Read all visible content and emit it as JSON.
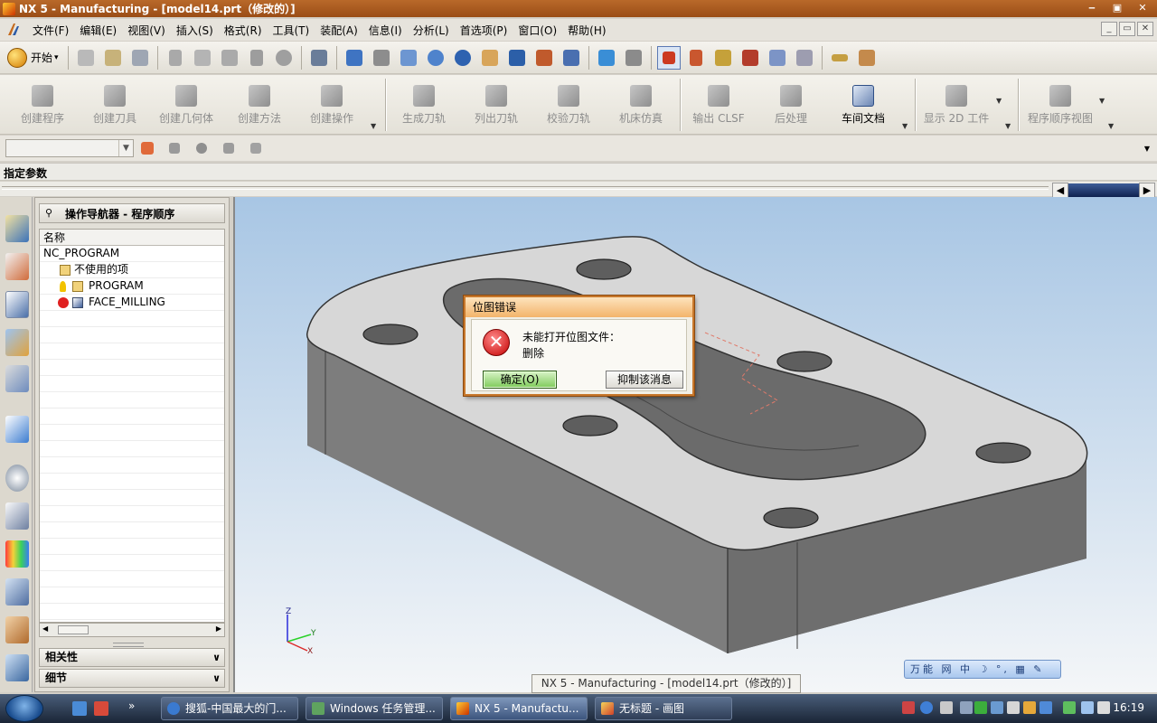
{
  "window": {
    "title": "NX 5 - Manufacturing - [model14.prt（修改的）]",
    "controls": [
      "‒",
      "▣",
      "✕"
    ]
  },
  "menu": {
    "items": [
      "文件(F)",
      "编辑(E)",
      "视图(V)",
      "插入(S)",
      "格式(R)",
      "工具(T)",
      "装配(A)",
      "信息(I)",
      "分析(L)",
      "首选项(P)",
      "窗口(O)",
      "帮助(H)"
    ],
    "mdi_controls": [
      "_",
      "▭",
      "✕"
    ]
  },
  "toolbar": {
    "start_label": "开始",
    "start_arrow": "▾"
  },
  "mfg_toolbar": {
    "buttons": [
      {
        "label": "创建程序",
        "icon": "create-program-icon",
        "enabled": false
      },
      {
        "label": "创建刀具",
        "icon": "create-tool-icon",
        "enabled": false
      },
      {
        "label": "创建几何体",
        "icon": "create-geometry-icon",
        "enabled": false
      },
      {
        "label": "创建方法",
        "icon": "create-method-icon",
        "enabled": false
      },
      {
        "label": "创建操作",
        "icon": "create-operation-icon",
        "enabled": false
      },
      {
        "label": "生成刀轨",
        "icon": "generate-toolpath-icon",
        "enabled": false
      },
      {
        "label": "列出刀轨",
        "icon": "list-toolpath-icon",
        "enabled": false
      },
      {
        "label": "校验刀轨",
        "icon": "verify-toolpath-icon",
        "enabled": false
      },
      {
        "label": "机床仿真",
        "icon": "machine-simulation-icon",
        "enabled": false
      },
      {
        "label": "输出 CLSF",
        "icon": "output-clsf-icon",
        "enabled": false
      },
      {
        "label": "后处理",
        "icon": "postprocess-icon",
        "enabled": false
      },
      {
        "label": "车间文档",
        "icon": "shop-documentation-icon",
        "enabled": true
      },
      {
        "label": "显示 2D 工件",
        "icon": "display-2d-workpiece-icon",
        "enabled": false
      },
      {
        "label": "程序顺序视图",
        "icon": "program-order-view-icon",
        "enabled": false
      }
    ]
  },
  "prompt": {
    "text": "指定参数"
  },
  "navigator": {
    "title": "操作导航器 - 程序顺序",
    "column_header": "名称",
    "rows": [
      {
        "label": "NC_PROGRAM",
        "icon": ""
      },
      {
        "label": "不使用的项",
        "icon": "folder-icon"
      },
      {
        "label": "PROGRAM",
        "icon": "program-folder-icon"
      },
      {
        "label": "FACE_MILLING",
        "icon": "operation-error-icon"
      }
    ],
    "panels": [
      "相关性",
      "细节"
    ]
  },
  "dialog": {
    "title": "位图错误",
    "message_line1": "未能打开位图文件：",
    "message_line2": "删除",
    "ok_label": "确定(O)",
    "suppress_label": "抑制该消息"
  },
  "viewport": {
    "caption": "NX 5 - Manufacturing - [model14.prt（修改的）]",
    "axis_labels": {
      "z": "Z",
      "y": "Y",
      "x": "X"
    },
    "ime_text": "万能 网 中 ☽ °, ▦ ✎"
  },
  "taskbar": {
    "tasks": [
      {
        "label": "搜狐-中国最大的门...",
        "active": false
      },
      {
        "label": "Windows 任务管理...",
        "active": false
      },
      {
        "label": "NX 5 - Manufactu...",
        "active": true
      },
      {
        "label": "无标题 - 画图",
        "active": false
      }
    ],
    "overflow": "»",
    "clock": "16:19"
  },
  "colors": {
    "titlebar": "#a9581c",
    "dialog_border": "#c8782c",
    "viewport_top": "#a8c6e4",
    "model_top": "#d7d7d7",
    "model_side": "#7a7a7a",
    "ok_button": "#7fcb5a"
  }
}
